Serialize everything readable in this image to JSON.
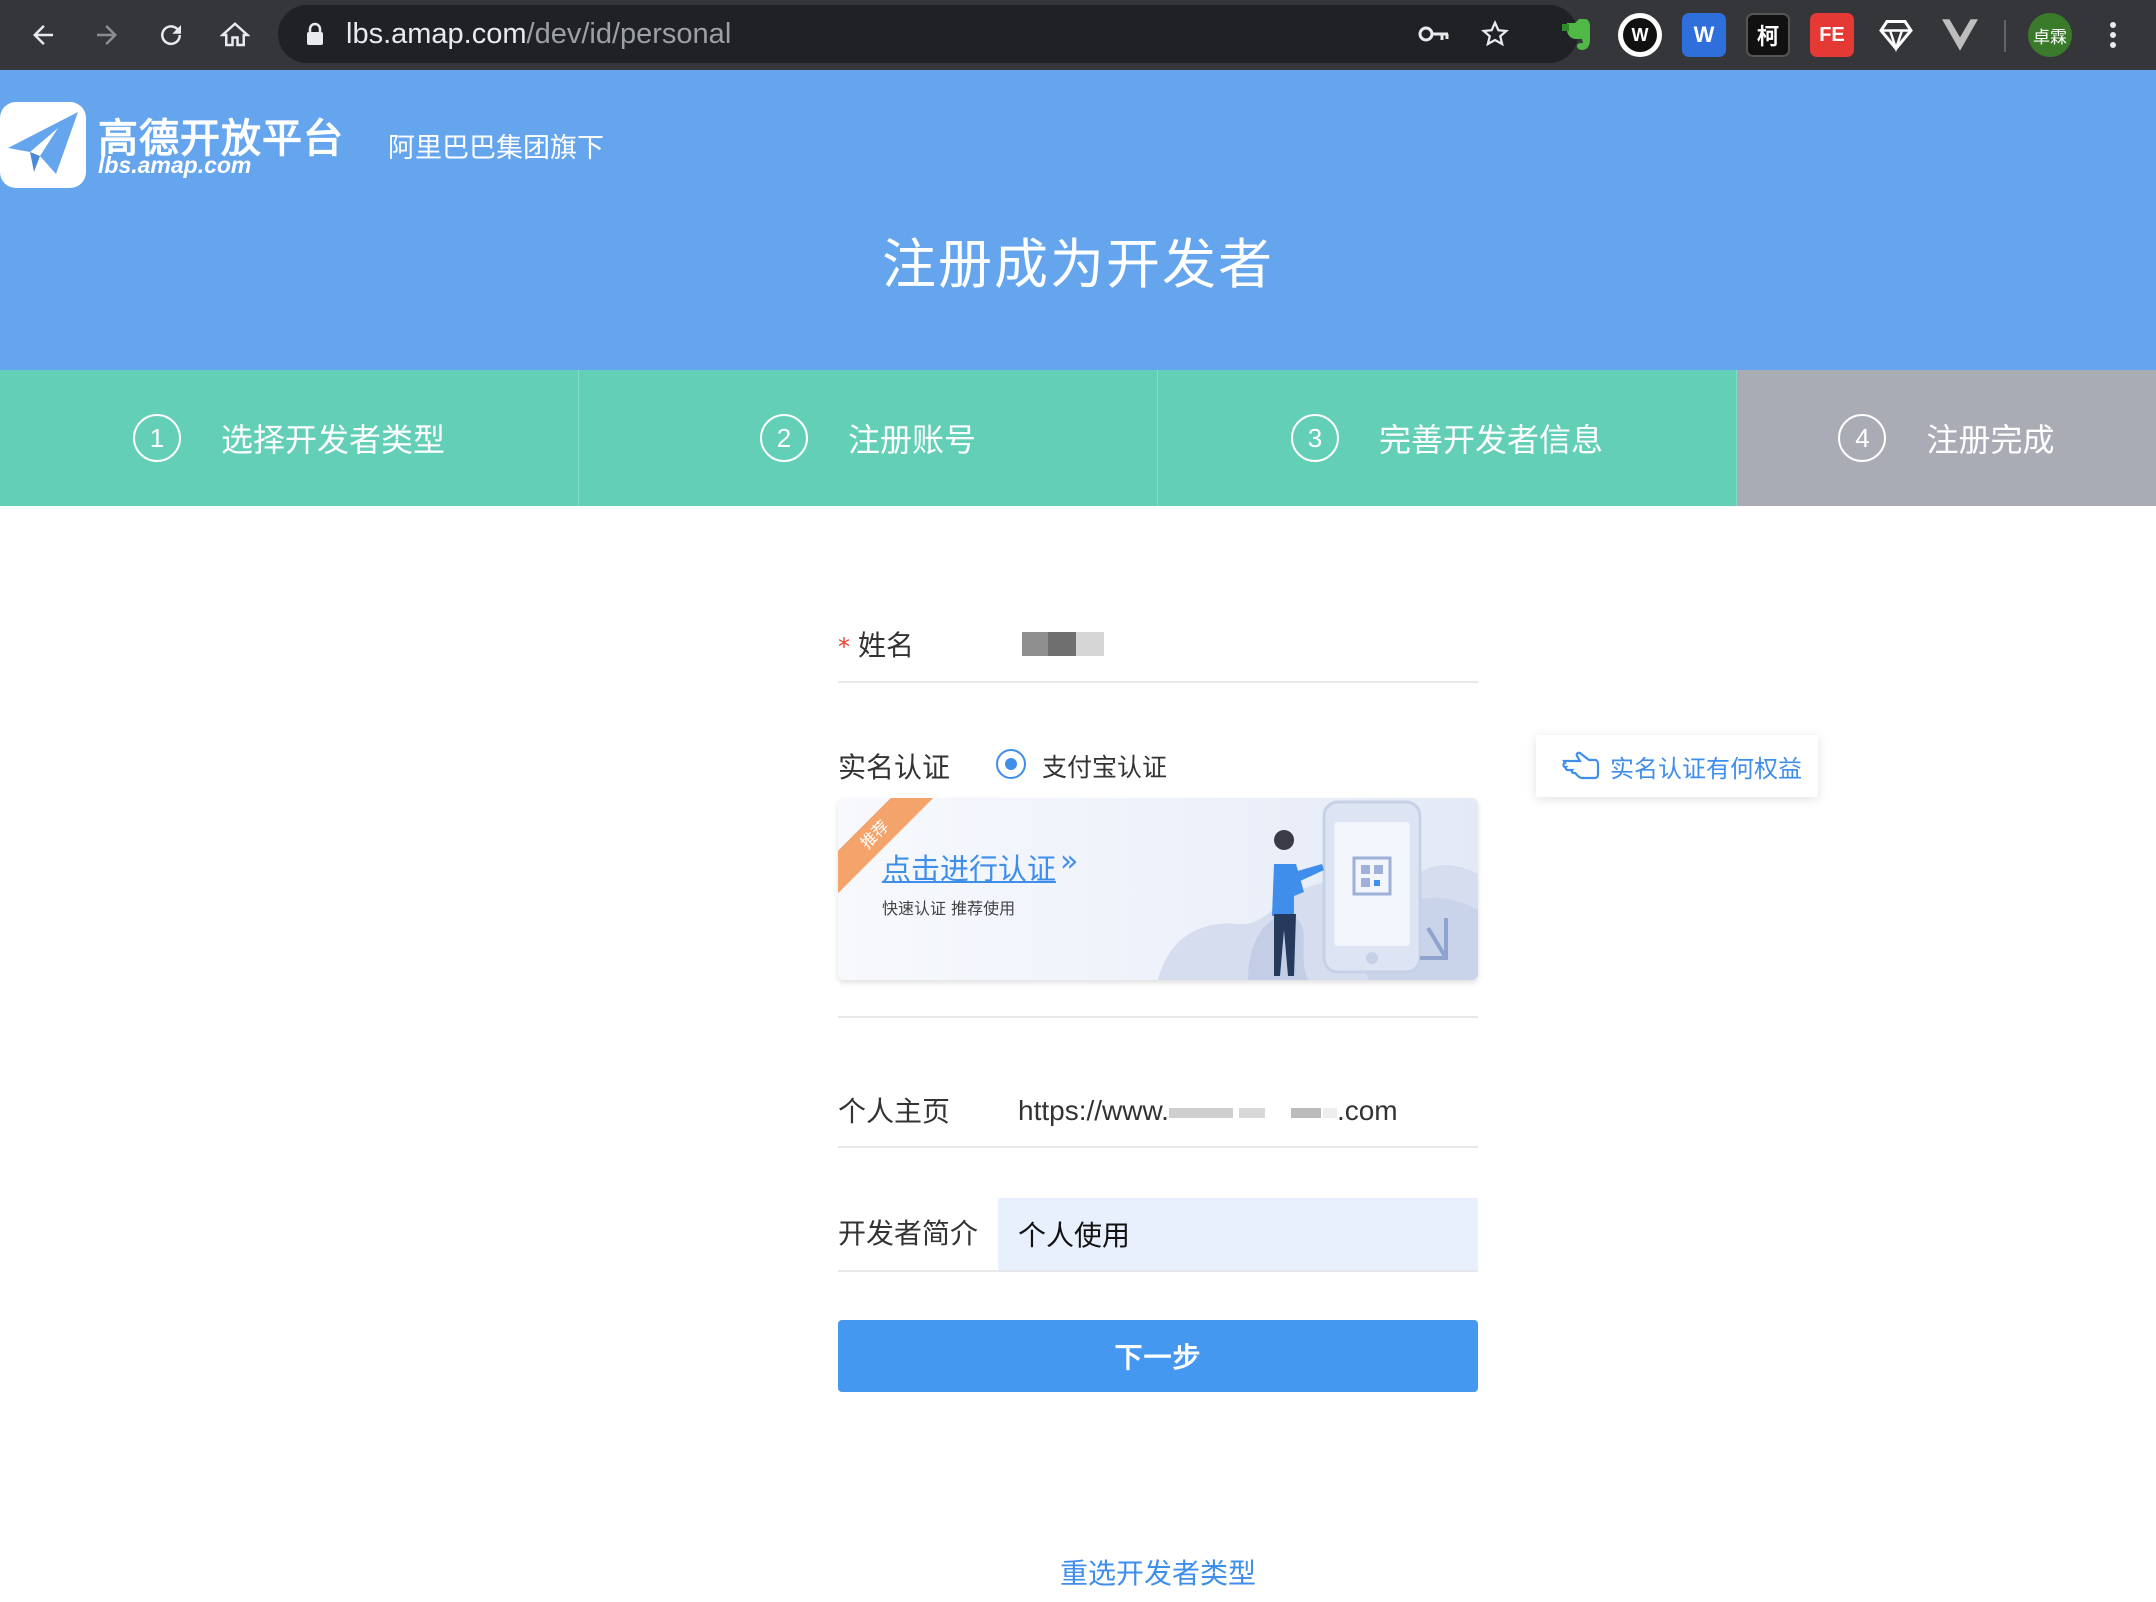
{
  "browser": {
    "url_host": "lbs.amap.com",
    "url_path": "/dev/id/personal",
    "profile_label": "卓霖",
    "extensions": [
      {
        "name": "evernote",
        "color": "#4fb846"
      },
      {
        "name": "w-circle",
        "color": "#ffffff"
      },
      {
        "name": "w-blue",
        "label": "W",
        "color": "#2f6fdb"
      },
      {
        "name": "ke",
        "label": "柯",
        "color": "#111111"
      },
      {
        "name": "fe",
        "label": "FE",
        "color": "#e53935"
      },
      {
        "name": "diamond",
        "color": "#ffffff"
      },
      {
        "name": "vue",
        "color": "#bdbdbd"
      }
    ]
  },
  "header": {
    "logo_name": "高德开放平台",
    "logo_domain": "lbs.amap.com",
    "subtitle": "阿里巴巴集团旗下",
    "title": "注册成为开发者"
  },
  "steps": [
    {
      "num": "1",
      "label": "选择开发者类型"
    },
    {
      "num": "2",
      "label": "注册账号"
    },
    {
      "num": "3",
      "label": "完善开发者信息"
    },
    {
      "num": "4",
      "label": "注册完成"
    }
  ],
  "form": {
    "name_required_mark": "*",
    "name_label": "姓名",
    "realname_label": "实名认证",
    "radio_label": "支付宝认证",
    "card": {
      "ribbon": "推荐",
      "link": "点击进行认证",
      "chevron": "»",
      "sub": "快速认证 推荐使用"
    },
    "benefit_label": "实名认证有何权益",
    "homepage_label": "个人主页",
    "homepage_prefix": "https://www.",
    "homepage_suffix": ".com",
    "intro_label": "开发者简介",
    "intro_value": "个人使用",
    "next_label": "下一步",
    "reselect_label": "重选开发者类型"
  },
  "colors": {
    "banner": "#64a5ee",
    "steps_done": "#62cfb6",
    "steps_pending": "#a9acb5",
    "primary": "#4498ef",
    "link": "#3f8eec"
  }
}
